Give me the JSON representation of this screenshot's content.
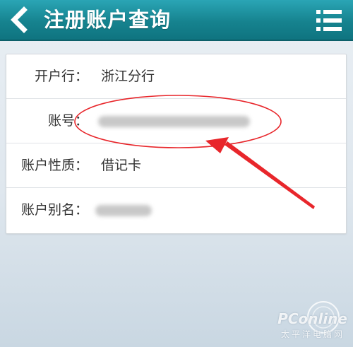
{
  "header": {
    "title": "注册账户查询",
    "back_icon": "chevron-left-icon",
    "menu_icon": "list-menu-icon",
    "background_color": "#16838f"
  },
  "account": {
    "rows": [
      {
        "label": "开户行：",
        "value": "浙江分行"
      },
      {
        "label": "账号：",
        "value": ""
      },
      {
        "label": "账户性质：",
        "value": "借记卡"
      },
      {
        "label": "账户别名：",
        "value": ""
      }
    ]
  },
  "annotation": {
    "color": "#e8262b"
  },
  "watermark": {
    "brand": "PConline",
    "subtitle": "太平洋电脑网"
  }
}
